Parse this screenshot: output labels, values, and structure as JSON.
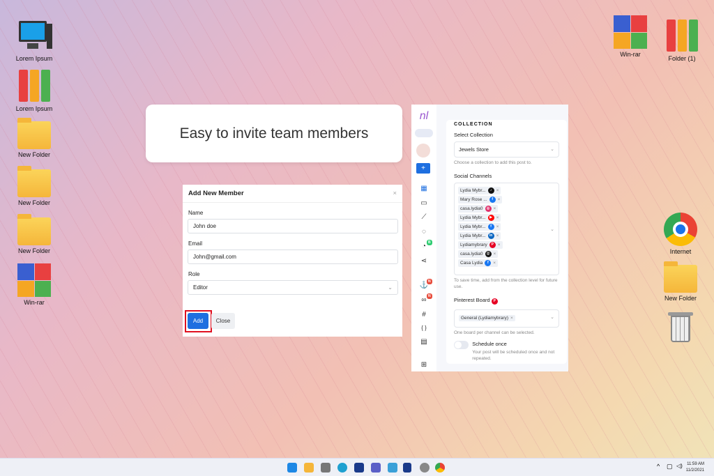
{
  "desktop_left": [
    {
      "label": "Lorem Ipsum",
      "icon": "computer"
    },
    {
      "label": "Lorem Ipsum",
      "icon": "binders"
    },
    {
      "label": "New Folder",
      "icon": "folder"
    },
    {
      "label": "New Folder",
      "icon": "folder"
    },
    {
      "label": "New Folder",
      "icon": "folder"
    },
    {
      "label": "Win-rar",
      "icon": "winrar"
    }
  ],
  "desktop_right": [
    {
      "label": "Win-rar"
    },
    {
      "label": "Folder (1)"
    },
    {
      "label": "Internet"
    },
    {
      "label": "New Folder"
    }
  ],
  "banner": "Easy to invite team members",
  "dialog": {
    "title": "Add New Member",
    "close": "×",
    "name_label": "Name",
    "name_value": "John doe",
    "email_label": "Email",
    "email_value": "John@gmail.com",
    "role_label": "Role",
    "role_value": "Editor",
    "add": "Add",
    "close_btn": "Close"
  },
  "panel": {
    "logo": "nl",
    "plus": "+",
    "badge_b": "B",
    "badge_n": "N",
    "hash": "#",
    "braces": "{ }",
    "section": "COLLECTION",
    "select_label": "Select Collection",
    "collection": "Jewels Store",
    "collection_hint": "Choose a collection to add this post to.",
    "channels_label": "Social Channels",
    "channels": [
      {
        "name": "Lydia Mybr...",
        "net": "tiktok",
        "color": "#111111",
        "g": "♪"
      },
      {
        "name": "Mary Rose ...",
        "net": "facebook",
        "color": "#1877f2",
        "g": "f"
      },
      {
        "name": "casa.lydia0",
        "net": "instagram",
        "color": "#e1306c",
        "g": "◎"
      },
      {
        "name": "Lydia Mybr...",
        "net": "youtube",
        "color": "#ff0000",
        "g": "▶"
      },
      {
        "name": "Lydia Mybr...",
        "net": "facebook",
        "color": "#1877f2",
        "g": "f"
      },
      {
        "name": "Lydia Mybr...",
        "net": "linkedin",
        "color": "#0a66c2",
        "g": "in"
      },
      {
        "name": "Lydiamybrary",
        "net": "pinterest",
        "color": "#e60023",
        "g": "P"
      },
      {
        "name": "casa.lydia0",
        "net": "threads",
        "color": "#111111",
        "g": "@"
      },
      {
        "name": "Casa Lydia",
        "net": "facebook",
        "color": "#1877f2",
        "g": "f"
      }
    ],
    "channels_hint": "To save time, add from the collection level for future use.",
    "pinterest_label": "Pinterest Board",
    "board": "General (Lydiamybrary)",
    "board_hint": "One board per channel can be selected.",
    "schedule_label": "Schedule once",
    "schedule_hint": "Your post will be scheduled once and not repeated."
  },
  "taskbar": {
    "time": "11:59 AM",
    "date": "11/2/2021"
  }
}
